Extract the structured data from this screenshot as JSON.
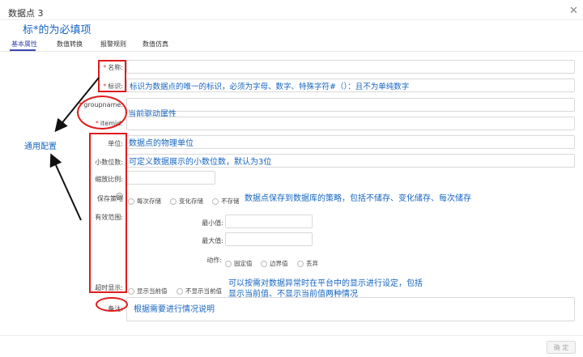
{
  "window": {
    "title": "数据点 3"
  },
  "annotations": {
    "required_note": "标*的为必填项",
    "identifier_note": "标识为数据点的唯一的标识，必须为字母、数字、特殊字符#（）：且不为单纯数字",
    "driver_note": "当前驱动属性",
    "unit_note": "数据点的物理单位",
    "decimal_note": "可定义数据展示的小数位数，默认为3位",
    "save_note": "数据点保存到数据库的策略，包括不储存、变化储存、每次储存",
    "timeout_note_1": "可以按需对数据异常时在平台中的显示进行设定，包括",
    "timeout_note_2": "显示当前值、不显示当前值两种情况",
    "remark_note": "根据需要进行情况说明",
    "common_config": "通用配置"
  },
  "tabs": [
    {
      "label": "基本属性",
      "active": true
    },
    {
      "label": "数值转换",
      "active": false
    },
    {
      "label": "报警规则",
      "active": false
    },
    {
      "label": "数值仿真",
      "active": false
    }
  ],
  "form": {
    "name_label": "名称:",
    "identifier_label": "标识:",
    "groupname_label": "groupname:",
    "itemid_label": "itemid:",
    "unit_label": "单位:",
    "decimal_label": "小数位数:",
    "scale_label": "缩放比例:",
    "save_label": "保存策略",
    "save_options": [
      "每次存储",
      "变化存储",
      "不存储"
    ],
    "range_label": "有效范围:",
    "min_label": "最小值:",
    "max_label": "最大值:",
    "action_label": "动作:",
    "action_options": [
      "固定值",
      "边界值",
      "丢弃"
    ],
    "timeout_label": "超时显示:",
    "timeout_options": [
      "显示当前值",
      "不显示当前值"
    ],
    "remark_label": "备注:",
    "required_mark": "*"
  },
  "footer": {
    "confirm_label": "确 定"
  },
  "icons": {
    "close": "close-icon",
    "help": "help-circle-icon"
  },
  "colors": {
    "accent": "#3949ab",
    "annotation": "#1565c0",
    "highlight": "#e01b1b"
  }
}
